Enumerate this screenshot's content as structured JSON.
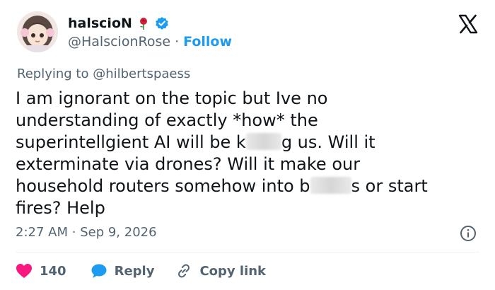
{
  "author": {
    "display_name": "halscioN",
    "handle": "@HalscionRose",
    "separator": "·",
    "follow_label": "Follow",
    "badge_icons": [
      "rose-icon",
      "verified-icon"
    ],
    "verified_color": "#1d9bf0"
  },
  "replying": {
    "prefix": "Replying to",
    "handle": "@hilbertspaess"
  },
  "tweet": {
    "text_part1": "I am ignorant on the topic but Ive no\nunderstanding of exactly *how* the\nsuperintellgient AI will be k",
    "text_part2": "g us. Will it\nexterminate via drones? Will it make our\nhousehold routers somehow into b",
    "text_part3": "s or start\nfires? Help"
  },
  "meta": {
    "time": "2:27 AM",
    "separator": "·",
    "date": "Sep 9, 2026"
  },
  "actions": {
    "like_count": "140",
    "reply_label": "Reply",
    "copy_label": "Copy link"
  },
  "colors": {
    "like": "#f91880",
    "reply": "#1d9bf0",
    "link": "#1d9bf0",
    "muted": "#536471"
  }
}
